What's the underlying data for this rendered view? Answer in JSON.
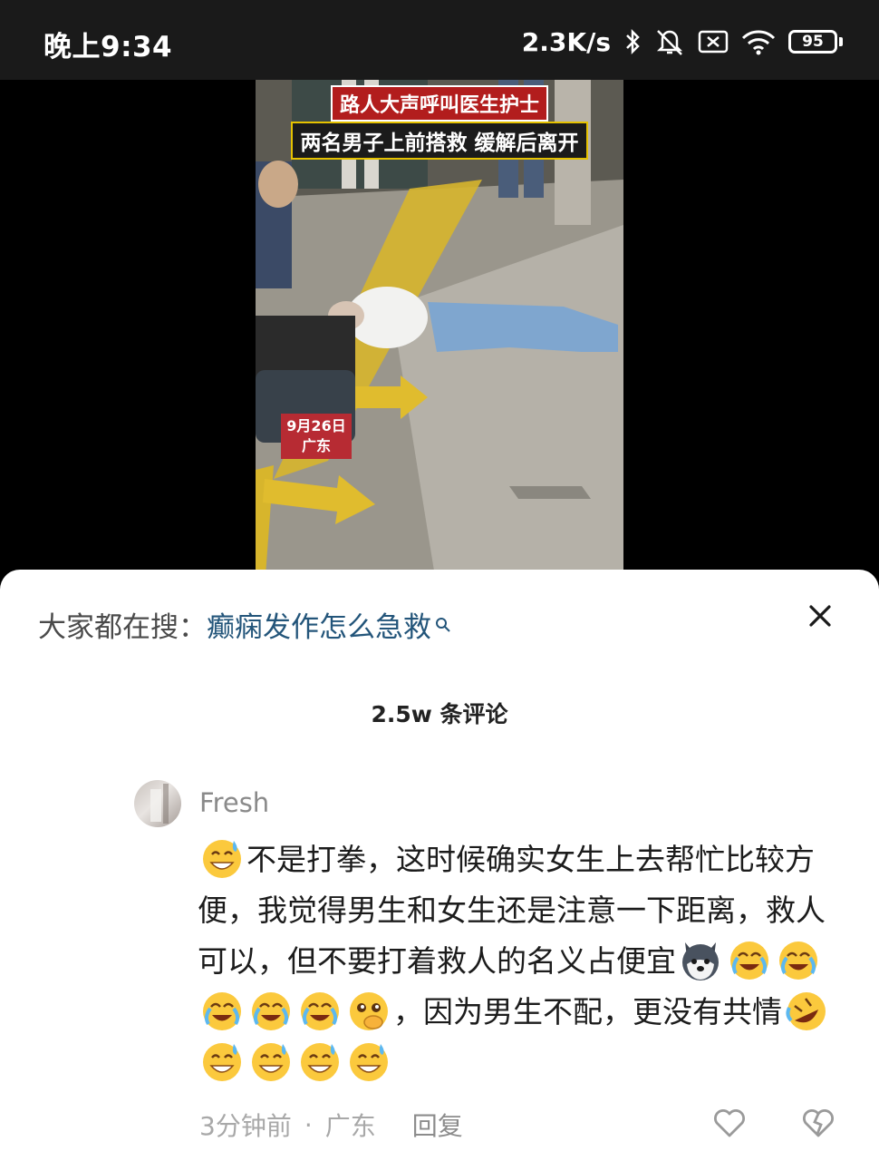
{
  "status_bar": {
    "time": "晚上9:34",
    "net_speed": "2.3K/s",
    "battery": "95"
  },
  "video": {
    "caption_line1": "路人大声呼叫医生护士",
    "caption_line2": "两名男子上前搭救 缓解后离开",
    "date_tag_line1": "9月26日",
    "date_tag_line2": "广东"
  },
  "sheet": {
    "search_prefix": "大家都在搜：",
    "search_term": "癫痫发作怎么急救",
    "comment_count": "2.5w 条评论"
  },
  "comment": {
    "username": "Fresh",
    "text_part1": "不是打拳，这时候确实女生上去帮忙比较方便，我觉得男生和女生还是注意一下距离，救人可以，但不要打着救人的名义占便宜",
    "text_part2": "，因为男生不配，更没有共情",
    "time": "3分钟前",
    "location": "广东",
    "reply_label": "回复"
  },
  "colors": {
    "sheet_bg": "#ffffff",
    "search_term": "#23557a",
    "muted_text": "#a8a8a8",
    "status_bar_bg": "#1a1a1a"
  }
}
